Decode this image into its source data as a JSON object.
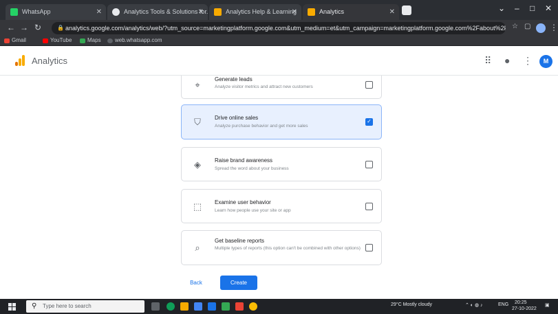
{
  "browser": {
    "tabs": [
      {
        "label": "WhatsApp"
      },
      {
        "label": "Analytics Tools & Solutions for..."
      },
      {
        "label": "Analytics Help & Learning"
      },
      {
        "label": "Analytics"
      }
    ],
    "url": "analytics.google.com/analytics/web/?utm_source=marketingplatform.google.com&utm_medium=et&utm_campaign=marketingplatform.google.com%2Fabout%2F...",
    "bookmarks": [
      "Gmail",
      "YouTube",
      "Maps",
      "web.whatsapp.com"
    ]
  },
  "header": {
    "title": "Analytics",
    "avatar_initial": "M"
  },
  "options": [
    {
      "title": "Generate leads",
      "description": "Analyze visitor metrics and attract new customers",
      "checked": false
    },
    {
      "title": "Drive online sales",
      "description": "Analyze purchase behavior and get more sales",
      "checked": true
    },
    {
      "title": "Raise brand awareness",
      "description": "Spread the word about your business",
      "checked": false
    },
    {
      "title": "Examine user behavior",
      "description": "Learn how people use your site or app",
      "checked": false
    },
    {
      "title": "Get baseline reports",
      "description": "Multiple types of reports (this option can't be combined with other options)",
      "checked": false
    }
  ],
  "actions": {
    "back_label": "Back",
    "create_label": "Create"
  },
  "taskbar": {
    "search_placeholder": "Type here to search",
    "weather": "29°C Mostly cloudy",
    "lang": "ENG",
    "time": "20:25",
    "date": "27-10-2022"
  },
  "colors": {
    "accent": "#1a73e8",
    "selected_bg": "#e8f0fe"
  }
}
